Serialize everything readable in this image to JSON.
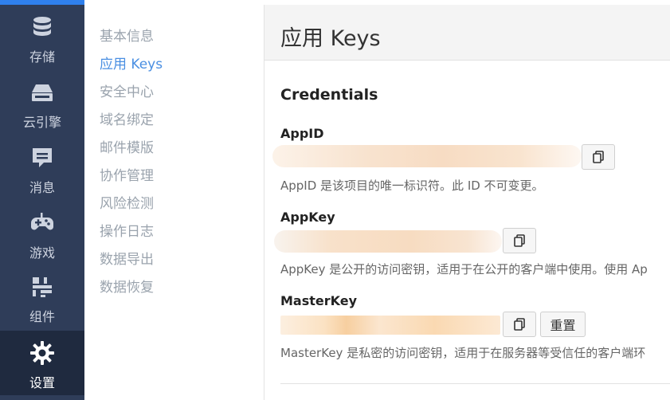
{
  "rail": {
    "items": [
      {
        "label": "存储",
        "icon": "database-icon"
      },
      {
        "label": "云引擎",
        "icon": "server-icon"
      },
      {
        "label": "消息",
        "icon": "message-icon"
      },
      {
        "label": "游戏",
        "icon": "gamepad-icon"
      },
      {
        "label": "组件",
        "icon": "components-icon"
      },
      {
        "label": "设置",
        "icon": "gear-icon",
        "active": true
      }
    ]
  },
  "subnav": {
    "items": [
      "基本信息",
      "应用 Keys",
      "安全中心",
      "域名绑定",
      "邮件模版",
      "协作管理",
      "风险检测",
      "操作日志",
      "数据导出",
      "数据恢复"
    ],
    "active_index": 1
  },
  "page": {
    "title": "应用 Keys",
    "section_title": "Credentials"
  },
  "credentials": {
    "appid": {
      "label": "AppID",
      "description": "AppID 是该项目的唯一标识符。此 ID 不可变更。"
    },
    "appkey": {
      "label": "AppKey",
      "description": "AppKey 是公开的访问密钥，适用于在公开的客户端中使用。使用 Ap"
    },
    "masterkey": {
      "label": "MasterKey",
      "reset_label": "重置",
      "description": "MasterKey 是私密的访问密钥，适用于在服务器等受信任的客户端环"
    }
  },
  "colors": {
    "rail_bg": "#2f3d59",
    "rail_active_bg": "#1f2a3f",
    "accent": "#4a8fe2",
    "top_bar": "#2f80ed"
  }
}
